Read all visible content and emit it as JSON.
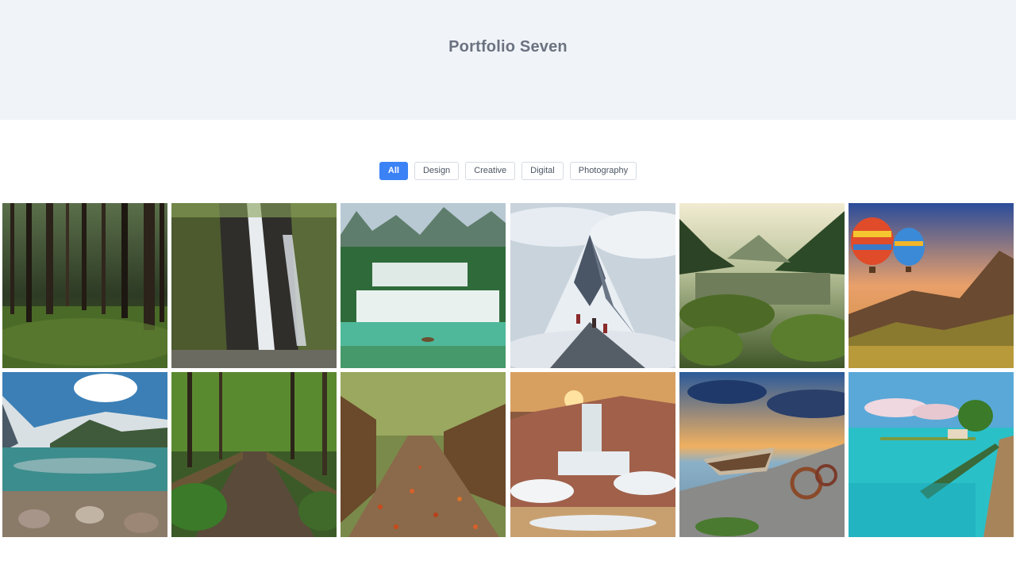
{
  "hero": {
    "title": "Portfolio Seven"
  },
  "filters": [
    {
      "label": "All",
      "active": true
    },
    {
      "label": "Design",
      "active": false
    },
    {
      "label": "Creative",
      "active": false
    },
    {
      "label": "Digital",
      "active": false
    },
    {
      "label": "Photography",
      "active": false
    }
  ],
  "colors": {
    "accent": "#3b82f6",
    "hero_bg": "#f0f4f8",
    "title": "#6b7280"
  },
  "gallery": [
    {
      "name": "forest-photo"
    },
    {
      "name": "waterfall-photo"
    },
    {
      "name": "terraced-waterfalls-photo"
    },
    {
      "name": "mountain-climbers-photo"
    },
    {
      "name": "mountain-lake-photo"
    },
    {
      "name": "hot-air-balloons-photo"
    },
    {
      "name": "alpine-lake-photo"
    },
    {
      "name": "forest-boardwalk-photo"
    },
    {
      "name": "autumn-path-photo"
    },
    {
      "name": "snowy-waterfall-photo"
    },
    {
      "name": "boat-shore-photo"
    },
    {
      "name": "tropical-pier-photo"
    }
  ]
}
